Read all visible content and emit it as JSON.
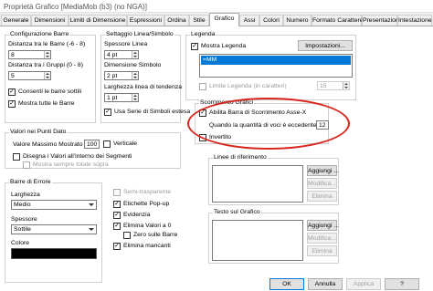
{
  "window": {
    "title": "Proprietà Grafico [MediaMob (b3) (no NGA)]"
  },
  "tabs": [
    "Generale",
    "Dimensioni",
    "Limiti di Dimensione",
    "Espressioni",
    "Ordina",
    "Stile",
    "Grafico",
    "Assi",
    "Colori",
    "Numero",
    "Formato Carattere",
    "Presentazione",
    "Intestazione"
  ],
  "bars_group": {
    "title": "Configurazione Barre",
    "gap_bars_label": "Distanza tra le Barre (-6 - 8)",
    "gap_bars_value": "8",
    "gap_groups_label": "Distanza tra i Gruppi (0 - 8)",
    "gap_groups_value": "5",
    "thin_bars": "Consenti le barre sottili",
    "show_all": "Mostra tutte le Barre"
  },
  "line_symbol_group": {
    "title": "Settaggio Linea/Simbolo",
    "line_width_label": "Spessore Linea",
    "line_width_value": "4 pt",
    "symbol_size_label": "Dimensione Simbolo",
    "symbol_size_value": "2 pt",
    "trend_width_label": "Larghezza linea di tendenza",
    "trend_width_value": "1 pt",
    "extended_symbols": "Usa Serie di Simboli estesa"
  },
  "legend_group": {
    "title": "Legenda",
    "show_legend": "Mostra Legenda",
    "settings_button": "Impostazioni...",
    "legend_item": "=MM",
    "limit_legend": "Limite Legenda (in caratteri)",
    "limit_value": "15"
  },
  "scroll_group": {
    "title": "Scorrimento Grafici",
    "enable_scroll": "Abilita Barra di Scorrimento Asse-X",
    "when_label": "Quando la quantità di voci è eccedente:",
    "when_value": "12",
    "inverted": "Invertito"
  },
  "values_group": {
    "title": "Valori nei Punti Dato",
    "max_label": "Valore Massimo Mostrato",
    "max_value": "100",
    "vertical": "Verticale",
    "draw_inside": "Disegna i Valori all'interno dei Segmenti",
    "always_top": "Mostra sempre totale sopra"
  },
  "error_bars_group": {
    "title": "Barre di Errore",
    "width_label": "Larghezza",
    "width_value": "Medio",
    "thickness_label": "Spessore",
    "thickness_value": "Sottile",
    "color_label": "Colore",
    "color_value": "#000000"
  },
  "misc_options": {
    "semitransparent": "Semi-trasparente",
    "popup_labels": "Etichette Pop-up",
    "highlight": "Evidenzia",
    "remove_zero": "Elimina Valori a 0",
    "zero_on_bars": "Zero sulle Barre",
    "remove_missing": "Elimina mancanti"
  },
  "reference_lines": {
    "title": "Linee di riferimento",
    "add": "Aggiungi ...",
    "edit": "Modifica...",
    "delete": "Elimina"
  },
  "chart_text": {
    "title": "Testo sul Grafico",
    "add": "Aggiungi ...",
    "edit": "Modifica...",
    "delete": "Elimina"
  },
  "footer": {
    "ok": "OK",
    "cancel": "Annulla",
    "apply": "Applica",
    "help": "?"
  },
  "colors": {
    "accent": "#0078d7",
    "highlight_circle": "#d9261c"
  }
}
